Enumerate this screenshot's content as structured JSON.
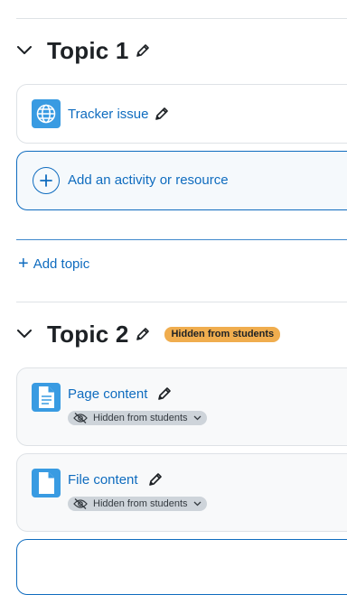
{
  "colors": {
    "link": "#0f6cbf",
    "activity_icon_bg": "#399be2",
    "hidden_badge_bg": "#f0ad4e",
    "visibility_badge_bg": "#ced4da"
  },
  "sections": [
    {
      "title": "Topic 1",
      "expand_icon": "chevron-down-icon",
      "edit_icon": "pencil-icon",
      "activities": [
        {
          "name": "Tracker issue",
          "icon": "globe-icon",
          "edit_icon": "pencil-icon"
        }
      ],
      "add_activity_label": "Add an activity or resource"
    },
    {
      "title": "Topic 2",
      "badge": "Hidden from students",
      "activities": [
        {
          "name": "Page content",
          "icon": "page-icon",
          "visibility": "Hidden from students"
        },
        {
          "name": "File content",
          "icon": "file-icon",
          "visibility": "Hidden from students"
        }
      ]
    }
  ],
  "add_topic": {
    "plus": "+",
    "label": "Add topic"
  }
}
